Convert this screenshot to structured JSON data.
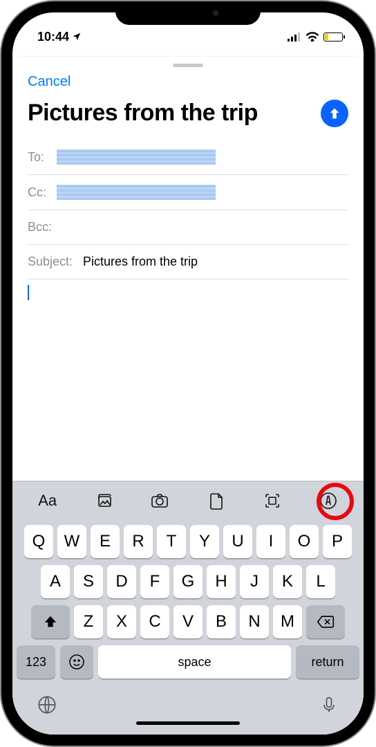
{
  "statusbar": {
    "time": "10:44"
  },
  "compose": {
    "cancel": "Cancel",
    "title": "Pictures from the trip",
    "to_label": "To:",
    "cc_label": "Cc:",
    "bcc_label": "Bcc:",
    "subject_label": "Subject:",
    "subject_value": "Pictures from the trip"
  },
  "toolbar": {
    "format": "Aa"
  },
  "keyboard": {
    "row1": [
      "Q",
      "W",
      "E",
      "R",
      "T",
      "Y",
      "U",
      "I",
      "O",
      "P"
    ],
    "row2": [
      "A",
      "S",
      "D",
      "F",
      "G",
      "H",
      "J",
      "K",
      "L"
    ],
    "row3": [
      "Z",
      "X",
      "C",
      "V",
      "B",
      "N",
      "M"
    ],
    "num": "123",
    "space": "space",
    "return": "return"
  }
}
